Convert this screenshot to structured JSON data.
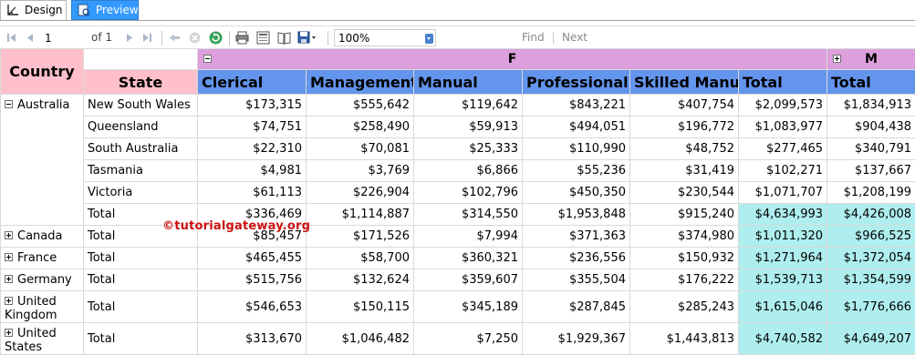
{
  "tabs": {
    "design": "Design",
    "preview": "Preview"
  },
  "toolbar": {
    "page_value": "1",
    "page_of": "of",
    "page_total": "1",
    "zoom": "100%",
    "find": "Find",
    "next": "Next",
    "icons": [
      "first-page-icon",
      "previous-page-icon",
      "next-page-icon",
      "last-page-icon",
      "back-icon",
      "stop-icon",
      "refresh-icon",
      "print-icon",
      "print-layout-icon",
      "page-setup-icon",
      "export-icon"
    ]
  },
  "report": {
    "header": {
      "country": "Country",
      "state": "State",
      "group_f": "F",
      "group_m": "M",
      "columns": [
        "Clerical",
        "Management",
        "Manual",
        "Professional",
        "Skilled Manual",
        "Total",
        "Total"
      ]
    },
    "rows": [
      {
        "country": "Australia",
        "expanded": true,
        "state": "New South Wales",
        "values": [
          "$173,315",
          "$555,642",
          "$119,642",
          "$843,221",
          "$407,754",
          "$2,099,573",
          "$1,834,913"
        ]
      },
      {
        "country": "",
        "state": "Queensland",
        "values": [
          "$74,751",
          "$258,490",
          "$59,913",
          "$494,051",
          "$196,772",
          "$1,083,977",
          "$904,438"
        ]
      },
      {
        "country": "",
        "state": "South Australia",
        "values": [
          "$22,310",
          "$70,081",
          "$25,333",
          "$110,990",
          "$48,752",
          "$277,465",
          "$340,791"
        ]
      },
      {
        "country": "",
        "state": "Tasmania",
        "values": [
          "$4,981",
          "$3,769",
          "$6,866",
          "$55,236",
          "$31,419",
          "$102,271",
          "$137,667"
        ]
      },
      {
        "country": "",
        "state": "Victoria",
        "values": [
          "$61,113",
          "$226,904",
          "$102,796",
          "$450,350",
          "$230,544",
          "$1,071,707",
          "$1,208,199"
        ]
      },
      {
        "country": "",
        "state": "Total",
        "values": [
          "$336,469",
          "$1,114,887",
          "$314,550",
          "$1,953,848",
          "$915,240",
          "$4,634,993",
          "$4,426,008"
        ]
      },
      {
        "country": "Canada",
        "expanded": false,
        "state": "Total",
        "values": [
          "$85,457",
          "$171,526",
          "$7,994",
          "$371,363",
          "$374,980",
          "$1,011,320",
          "$966,525"
        ]
      },
      {
        "country": "France",
        "expanded": false,
        "state": "Total",
        "values": [
          "$465,455",
          "$58,700",
          "$360,321",
          "$236,556",
          "$150,932",
          "$1,271,964",
          "$1,372,054"
        ]
      },
      {
        "country": "Germany",
        "expanded": false,
        "state": "Total",
        "values": [
          "$515,756",
          "$132,624",
          "$359,607",
          "$355,504",
          "$176,222",
          "$1,539,713",
          "$1,354,599"
        ]
      },
      {
        "country": "United Kingdom",
        "expanded": false,
        "state": "Total",
        "values": [
          "$546,653",
          "$150,115",
          "$345,189",
          "$287,845",
          "$285,243",
          "$1,615,046",
          "$1,776,666"
        ]
      },
      {
        "country": "United States",
        "expanded": false,
        "state": "Total",
        "values": [
          "$313,670",
          "$1,046,482",
          "$7,250",
          "$1,929,367",
          "$1,443,813",
          "$4,740,582",
          "$4,649,207"
        ]
      }
    ],
    "watermark": "©tutorialgateway.org"
  },
  "colors": {
    "header_pink": "#ffc0cb",
    "header_plum": "#dda0dd",
    "header_blue": "#6495ed",
    "grand_total": "#afeeee",
    "tab_active": "#3399ff"
  }
}
